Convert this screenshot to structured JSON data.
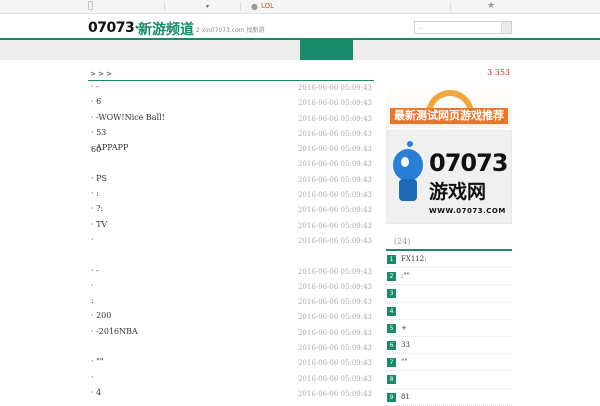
{
  "topbar": {
    "apple_icon": "apple-icon",
    "android_icon": "android-icon",
    "lol_label": "LOL",
    "star_icon": "star-icon",
    "caret": "▾"
  },
  "header": {
    "logo_num": "07073",
    "logo_dot": "·",
    "channel": "新游频道",
    "url_text": "2  xin07073.com  找新游",
    "search_placeholder": "..."
  },
  "crumb": "> > >",
  "right_head": "3   353",
  "articles": [
    {
      "title": "· -",
      "date": "2016-06-06 05:09:43"
    },
    {
      "title": "· 6",
      "date": "2016-06-06 05:09:43"
    },
    {
      "title": "· -WOW!Nice Ball!",
      "date": "2016-06-06 05:09:43"
    },
    {
      "title": "· 53",
      "date": "2016-06-06 05:09:43"
    },
    {
      "title": "· APPAPP",
      "date": "2016-06-06 05:09:43"
    },
    {
      "title": "",
      "date": "2016-06-06 05:09:43"
    },
    {
      "title": "· PS",
      "date": "2016-06-06 05:09:43"
    },
    {
      "title": "· :",
      "date": "2016-06-06 05:09:43"
    },
    {
      "title": "· ?:",
      "date": "2016-06-06 05:09:43"
    },
    {
      "title": "· TV",
      "date": "2016-06-06 05:09:43"
    },
    {
      "title": "·",
      "date": "2016-06-06 05:09:43"
    },
    {
      "title": "",
      "date": ""
    },
    {
      "title": "· -",
      "date": "2016-06-06 05:09:43"
    },
    {
      "title": "·",
      "date": "2016-06-06 05:09:43"
    },
    {
      "title": ":",
      "date": "2016-06-06 05:09:43"
    },
    {
      "title": "· 200",
      "date": "2016-06-06 05:09:43"
    },
    {
      "title": "· -2016NBA",
      "date": "2016-06-06 05:09:43"
    },
    {
      "title": "",
      "date": "2016-06-06 05:09:43"
    },
    {
      "title": "· \"\"",
      "date": "2016-06-06 05:09:43"
    },
    {
      "title": "·",
      "date": "2016-06-06 05:09:43"
    },
    {
      "title": "· 4",
      "date": "2016-06-06 05:09:43"
    }
  ],
  "extra_60": "60",
  "banner1": {
    "text": "最新测试网页游戏推荐"
  },
  "banner2": {
    "big": "07073",
    "cn": "游戏网",
    "url": "WWW.07073.COM"
  },
  "rank": {
    "title": "(24)",
    "items": [
      {
        "num": "1",
        "text": "FX112:"
      },
      {
        "num": "2",
        "text": ":\"\""
      },
      {
        "num": "3",
        "text": ""
      },
      {
        "num": "4",
        "text": ""
      },
      {
        "num": "5",
        "text": "+"
      },
      {
        "num": "6",
        "text": "33"
      },
      {
        "num": "7",
        "text": "\"\""
      },
      {
        "num": "8",
        "text": ""
      },
      {
        "num": "9",
        "text": "81"
      }
    ]
  }
}
